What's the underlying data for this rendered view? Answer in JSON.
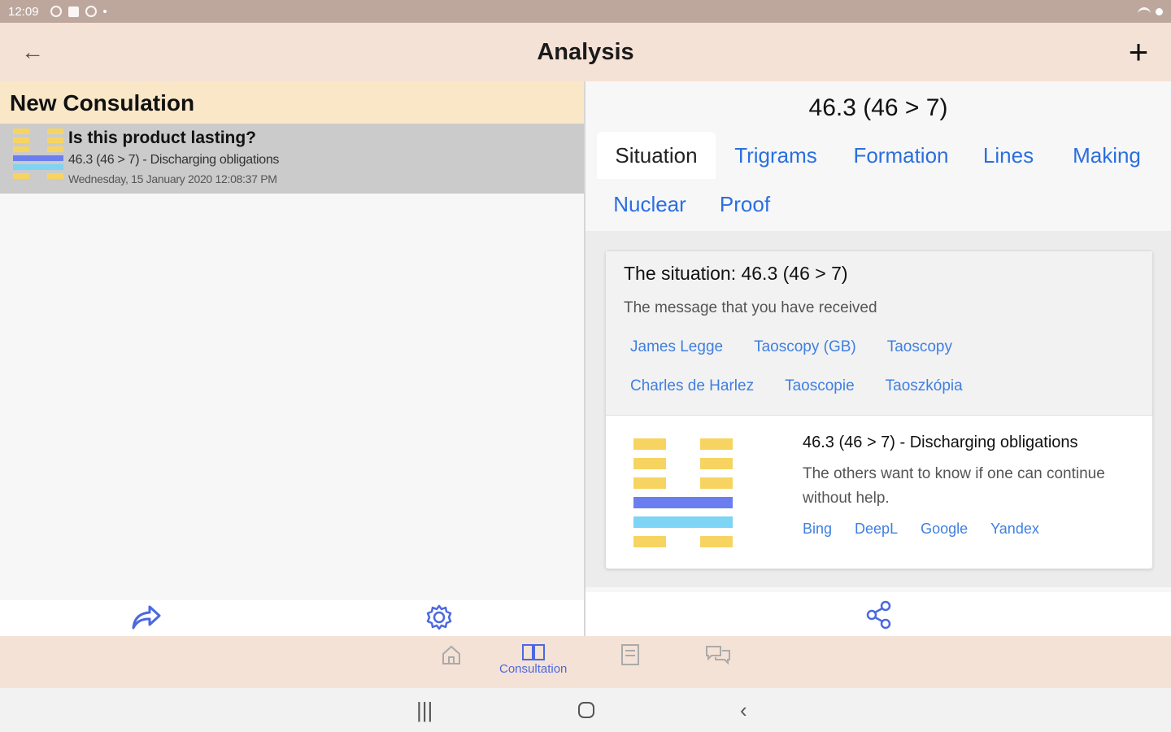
{
  "status_bar": {
    "time": "12:09"
  },
  "app_bar": {
    "title": "Analysis",
    "back_icon": "arrow-back-icon",
    "add_icon": "plus-icon"
  },
  "left_pane": {
    "section_title": "New Consulation",
    "consultation": {
      "question": "Is this product lasting?",
      "summary": "46.3 (46 > 7) - Discharging obligations",
      "date": "Wednesday, 15 January 2020 12:08:37 PM"
    }
  },
  "right_pane": {
    "heading": "46.3 (46 > 7)",
    "tabs": [
      "Situation",
      "Trigrams",
      "Formation",
      "Lines",
      "Making",
      "Nuclear",
      "Proof"
    ],
    "active_tab": "Situation",
    "card": {
      "title": "The situation: 46.3 (46 > 7)",
      "subtitle": "The message that you have received",
      "sources_row1": [
        "James Legge",
        "Taoscopy (GB)",
        "Taoscopy"
      ],
      "sources_row2": [
        "Charles de Harlez",
        "Taoscopie",
        "Taoszkópia"
      ],
      "hexagram_title": "46.3 (46 > 7) - Discharging obligations",
      "hexagram_desc": "The others want to know if one can continue without help.",
      "translators": [
        "Bing",
        "DeepL",
        "Google",
        "Yandex"
      ]
    }
  },
  "bottom_nav": {
    "active_label": "Consultation"
  },
  "colors": {
    "accent": "#4c68e0",
    "link": "#2a6fe0",
    "yin": "#f7d462",
    "yang_moving": "#6a7ef0",
    "yang": "#7dd4f5",
    "appbar_bg": "#f5e2d6"
  }
}
